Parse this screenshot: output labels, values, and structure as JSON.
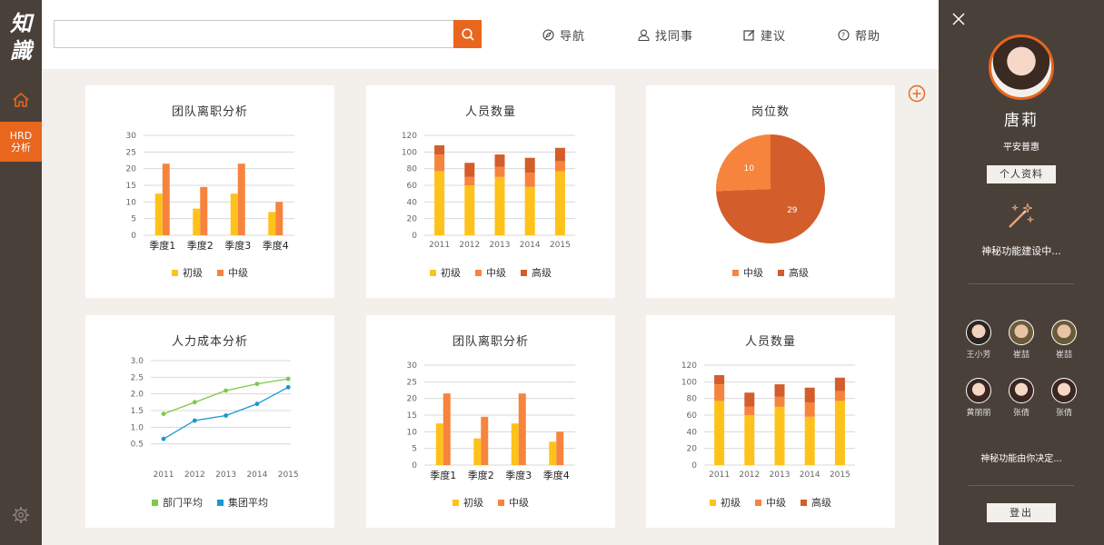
{
  "app": {
    "logo_text": "知識",
    "hrd_label_1": "HRD",
    "hrd_label_2": "分析",
    "icons": {
      "home": "home-icon",
      "settings": "gear-icon",
      "search": "search-icon"
    }
  },
  "header": {
    "search": {
      "value": "",
      "placeholder": ""
    },
    "nav": [
      {
        "label": "导航",
        "icon": "compass-icon"
      },
      {
        "label": "找同事",
        "icon": "person-icon"
      },
      {
        "label": "建议",
        "icon": "edit-icon"
      },
      {
        "label": "帮助",
        "icon": "help-icon"
      }
    ]
  },
  "colors": {
    "accent": "#e8661d",
    "yellow": "#ffc21a",
    "orange": "#f7843c",
    "dark_orange": "#d35d2b",
    "green": "#7ec94a",
    "blue": "#1b96d2",
    "sidebar": "#4a403a"
  },
  "chart_data": [
    {
      "type": "bar",
      "title": "团队离职分析",
      "categories": [
        "季度1",
        "季度2",
        "季度3",
        "季度4"
      ],
      "ylim": [
        0,
        30
      ],
      "yticks": [
        0,
        5,
        10,
        15,
        20,
        25,
        30
      ],
      "series": [
        {
          "name": "初级",
          "values": [
            12.5,
            8,
            12.5,
            7
          ]
        },
        {
          "name": "中级",
          "values": [
            21.5,
            14.5,
            21.5,
            10
          ]
        }
      ],
      "grid": true,
      "legend": "bottom"
    },
    {
      "type": "bar",
      "stacked": true,
      "title": "人员数量",
      "categories": [
        "2011",
        "2012",
        "2013",
        "2014",
        "2015"
      ],
      "ylim": [
        0,
        120
      ],
      "yticks": [
        0,
        20,
        40,
        60,
        80,
        100,
        120
      ],
      "series": [
        {
          "name": "初级",
          "values": [
            77,
            60,
            70,
            58,
            77
          ]
        },
        {
          "name": "中级",
          "values": [
            20,
            10,
            12,
            17,
            12
          ]
        },
        {
          "name": "高级",
          "values": [
            11,
            17,
            15,
            18,
            16
          ]
        }
      ],
      "grid": true,
      "legend": "bottom"
    },
    {
      "type": "pie",
      "title": "岗位数",
      "slices": [
        {
          "name": "中级",
          "value": 10
        },
        {
          "name": "高级",
          "value": 29
        }
      ],
      "legend": "bottom"
    },
    {
      "type": "line",
      "title": "人力成本分析",
      "categories": [
        "2011",
        "2012",
        "2013",
        "2014",
        "2015"
      ],
      "ylim": [
        0,
        3.0
      ],
      "yticks": [
        "0.5",
        "1.0",
        "1.5",
        "2.0",
        "2.5",
        "3.0"
      ],
      "series": [
        {
          "name": "部门平均",
          "values": [
            1.4,
            1.75,
            2.1,
            2.3,
            2.45
          ]
        },
        {
          "name": "集团平均",
          "values": [
            0.65,
            1.2,
            1.35,
            1.7,
            2.2
          ]
        }
      ],
      "grid": true,
      "legend": "bottom"
    },
    {
      "type": "bar",
      "title": "团队离职分析",
      "categories": [
        "季度1",
        "季度2",
        "季度3",
        "季度4"
      ],
      "ylim": [
        0,
        30
      ],
      "yticks": [
        0,
        5,
        10,
        15,
        20,
        25,
        30
      ],
      "series": [
        {
          "name": "初级",
          "values": [
            12.5,
            8,
            12.5,
            7
          ]
        },
        {
          "name": "中级",
          "values": [
            21.5,
            14.5,
            21.5,
            10
          ]
        }
      ],
      "grid": true,
      "legend": "bottom"
    },
    {
      "type": "bar",
      "stacked": true,
      "title": "人员数量",
      "categories": [
        "2011",
        "2012",
        "2013",
        "2014",
        "2015"
      ],
      "ylim": [
        0,
        120
      ],
      "yticks": [
        0,
        20,
        40,
        60,
        80,
        100,
        120
      ],
      "series": [
        {
          "name": "初级",
          "values": [
            77,
            60,
            70,
            58,
            77
          ]
        },
        {
          "name": "中级",
          "values": [
            20,
            10,
            12,
            17,
            12
          ]
        },
        {
          "name": "高级",
          "values": [
            11,
            17,
            15,
            18,
            16
          ]
        }
      ],
      "grid": true,
      "legend": "bottom"
    }
  ],
  "profile": {
    "name": "唐莉",
    "org": "平安普惠",
    "profile_button": "个人资料",
    "mystery_1": "神秘功能建设中...",
    "colleagues": [
      {
        "name": "王小芳"
      },
      {
        "name": "崔喆"
      },
      {
        "name": "崔喆"
      },
      {
        "name": "黄丽丽"
      },
      {
        "name": "张倩"
      },
      {
        "name": "张倩"
      }
    ],
    "mystery_2": "神秘功能由你决定...",
    "logout": "登出"
  }
}
